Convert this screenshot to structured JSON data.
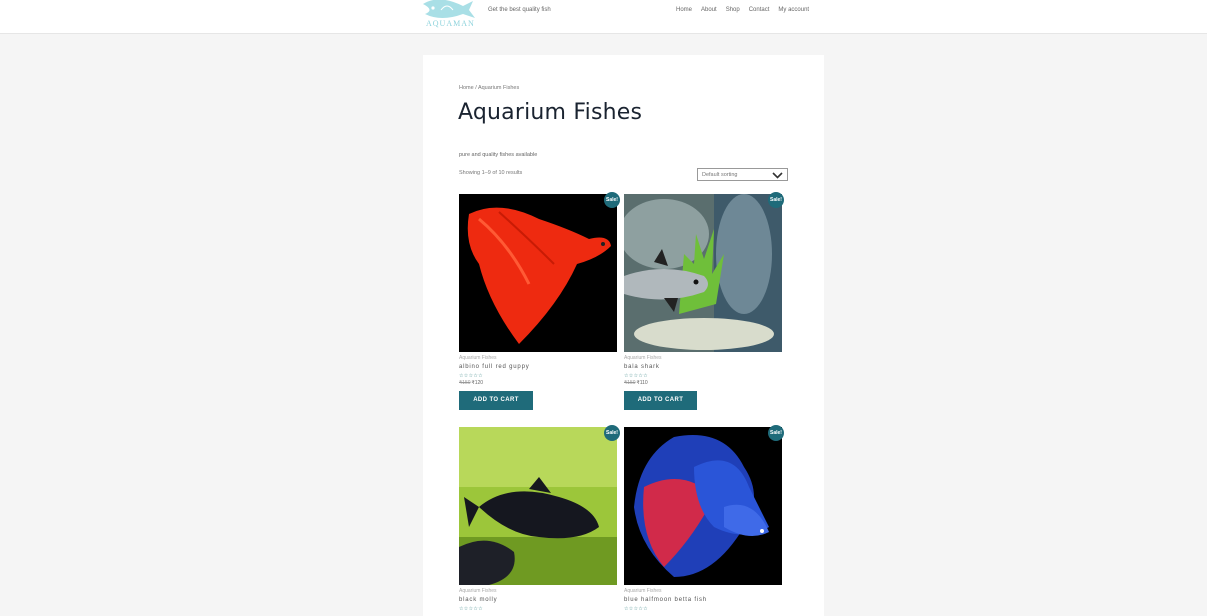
{
  "header": {
    "logo_text": "AQUAMAN",
    "tagline": "Get the best quality fish",
    "nav": [
      "Home",
      "About",
      "Shop",
      "Contact",
      "My account"
    ]
  },
  "breadcrumb": "Home / Aquarium Fishes",
  "title": "Aquarium Fishes",
  "description": "pure and quality fishes available",
  "result_count": "Showing 1–9 of 10 results",
  "sort_selected": "Default sorting",
  "products": [
    {
      "category": "Aquarium Fishes",
      "name": "albino full red guppy",
      "stars": "☆☆☆☆☆",
      "old_price": "₹150",
      "price": "₹120",
      "button": "ADD TO CART",
      "badge": "Sale!"
    },
    {
      "category": "Aquarium Fishes",
      "name": "bala shark",
      "stars": "☆☆☆☆☆",
      "old_price": "₹150",
      "price": "₹110",
      "button": "ADD TO CART",
      "badge": "Sale!"
    },
    {
      "category": "Aquarium Fishes",
      "name": "black molly",
      "stars": "☆☆☆☆☆",
      "old_price": "",
      "price": "",
      "button": "",
      "badge": "Sale!"
    },
    {
      "category": "Aquarium Fishes",
      "name": "blue halfmoon betta fish",
      "stars": "☆☆☆☆☆",
      "old_price": "",
      "price": "",
      "button": "",
      "badge": "Sale!"
    }
  ],
  "colors": {
    "accent": "#1f6b7a",
    "page_bg": "#f5f5f5",
    "title": "#1a2330"
  }
}
